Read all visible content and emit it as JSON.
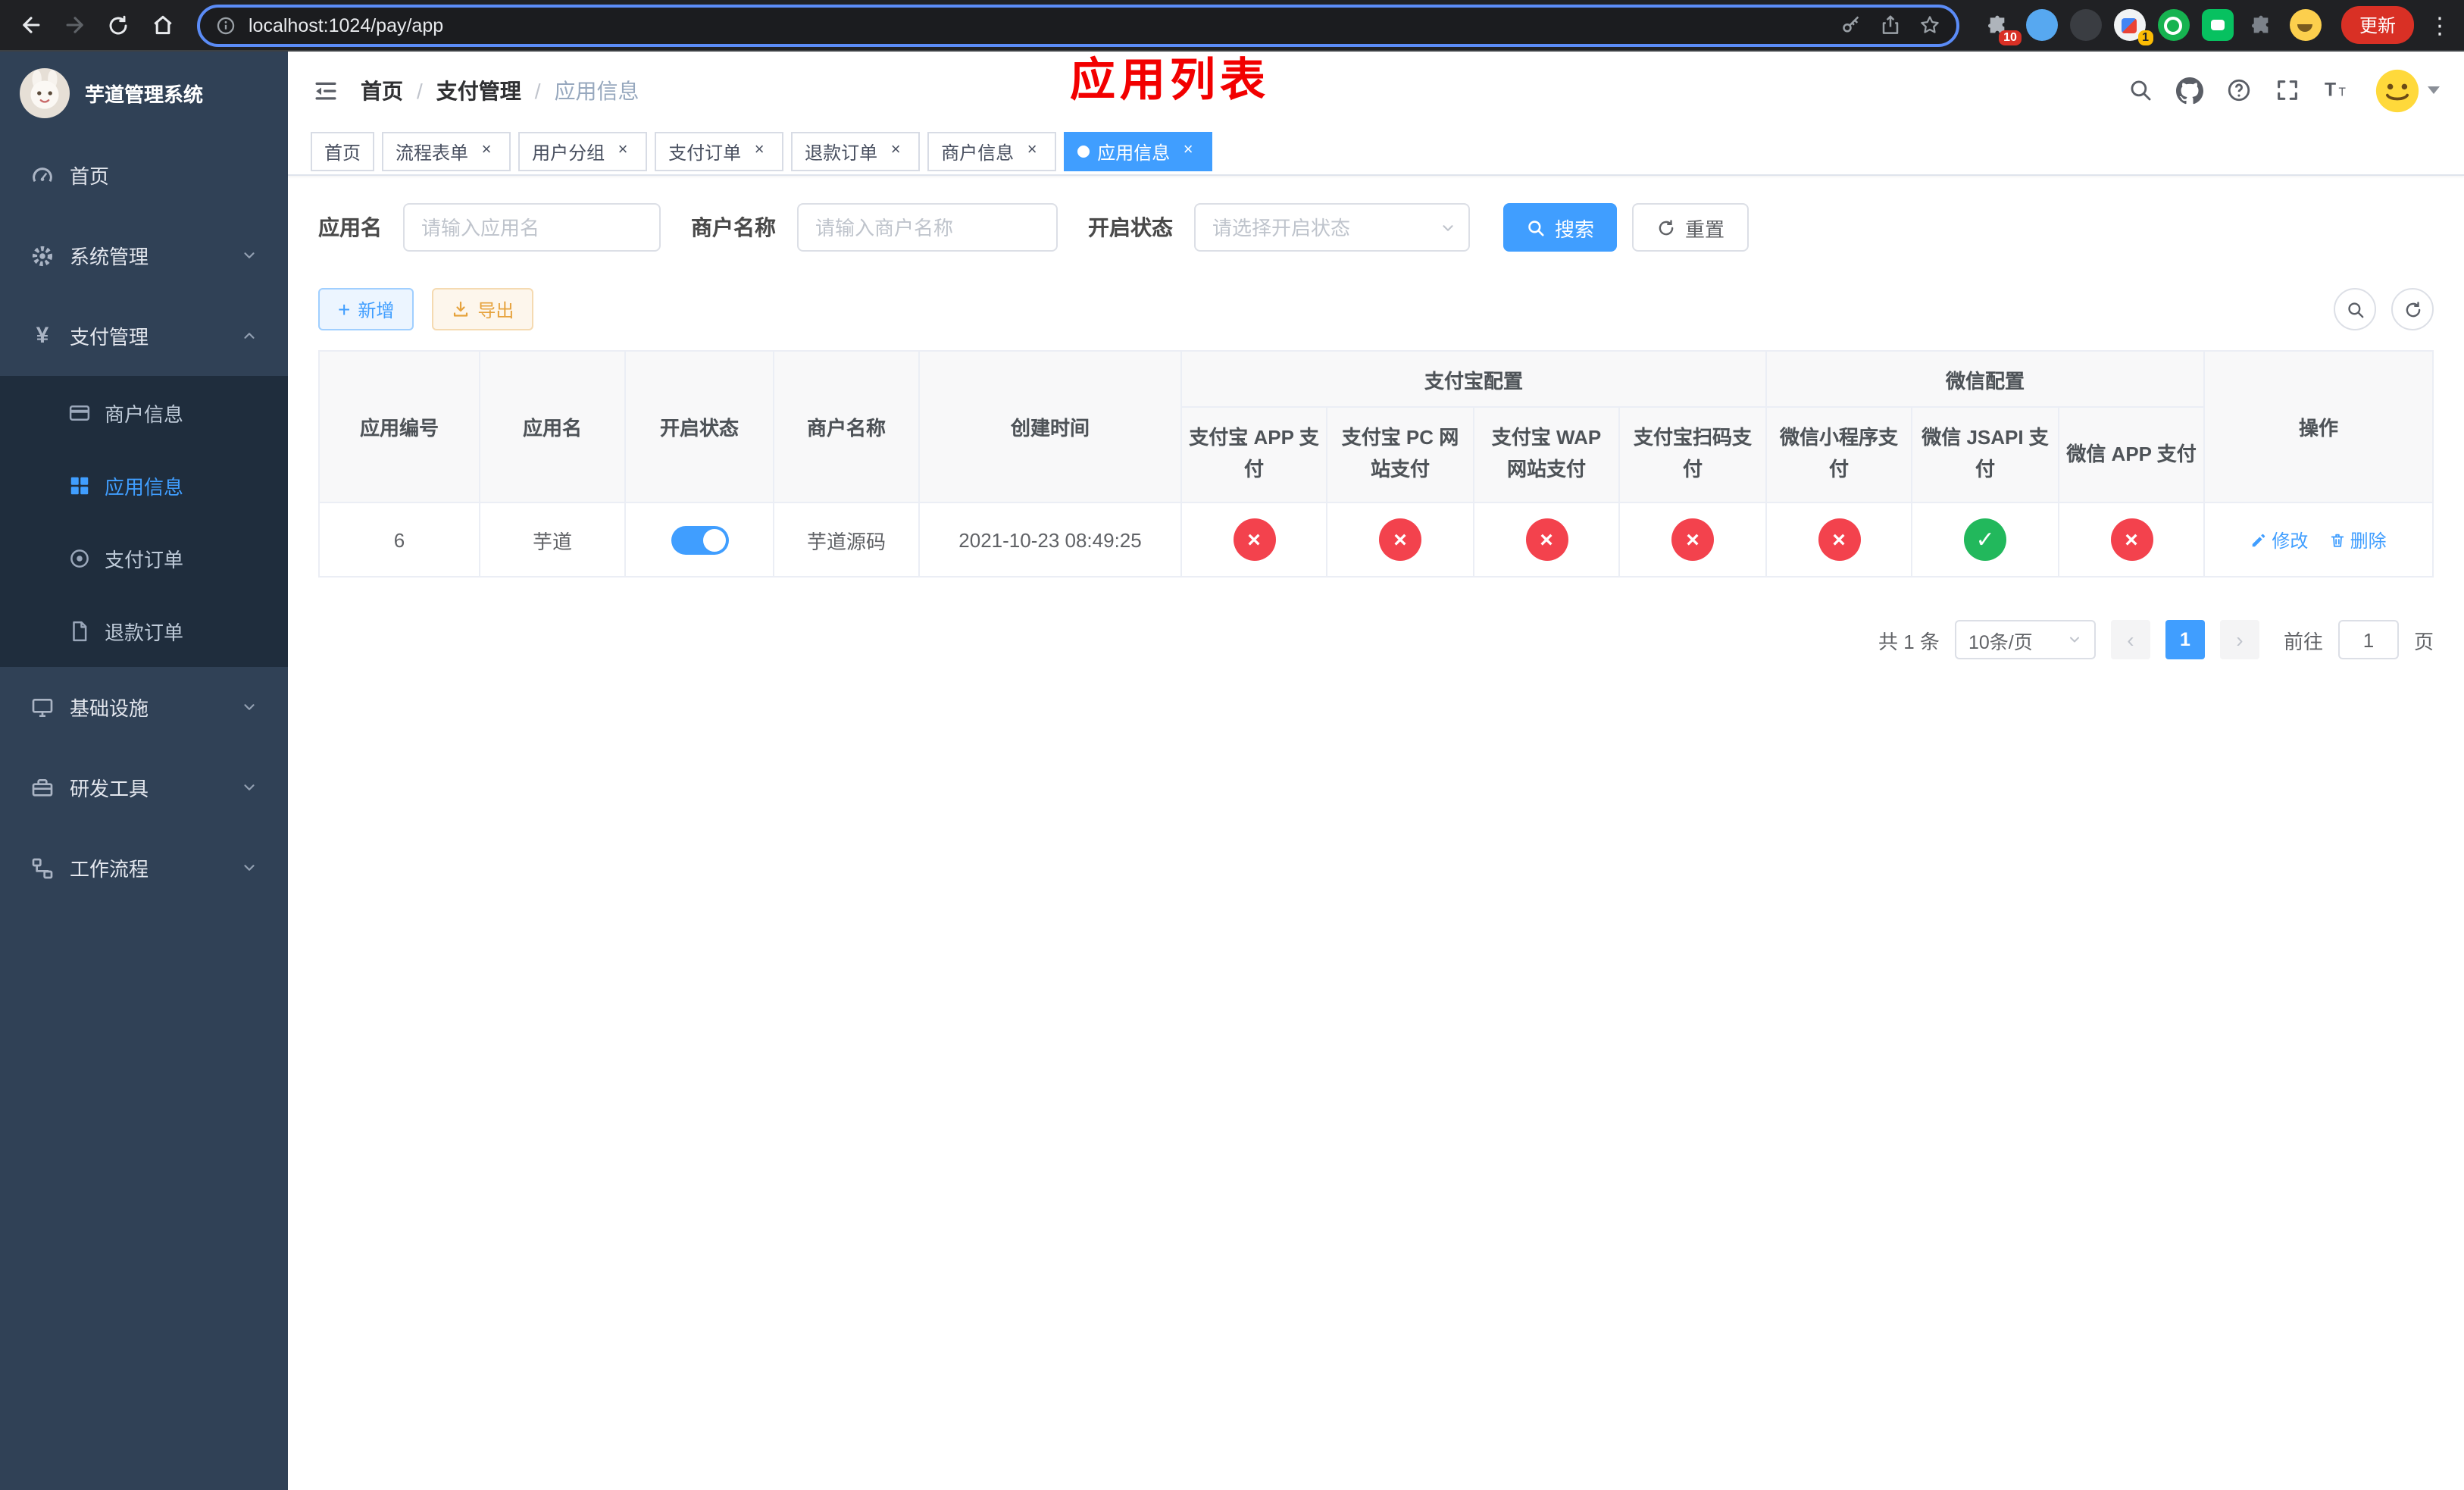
{
  "browser": {
    "url": "localhost:1024/pay/app",
    "update_label": "更新",
    "ext_badge_1": "10",
    "ext_badge_2": "1"
  },
  "sidebar": {
    "title": "芋道管理系统",
    "items": [
      {
        "label": "首页"
      },
      {
        "label": "系统管理",
        "expandable": true
      },
      {
        "label": "支付管理",
        "expanded": true,
        "children": [
          {
            "label": "商户信息"
          },
          {
            "label": "应用信息",
            "active": true
          },
          {
            "label": "支付订单"
          },
          {
            "label": "退款订单"
          }
        ]
      },
      {
        "label": "基础设施",
        "expandable": true
      },
      {
        "label": "研发工具",
        "expandable": true
      },
      {
        "label": "工作流程",
        "expandable": true
      }
    ]
  },
  "navbar": {
    "breadcrumb": [
      "首页",
      "支付管理",
      "应用信息"
    ],
    "annotation": "应用列表"
  },
  "tabs": [
    {
      "label": "首页",
      "closable": false
    },
    {
      "label": "流程表单",
      "closable": true
    },
    {
      "label": "用户分组",
      "closable": true
    },
    {
      "label": "支付订单",
      "closable": true
    },
    {
      "label": "退款订单",
      "closable": true
    },
    {
      "label": "商户信息",
      "closable": true
    },
    {
      "label": "应用信息",
      "closable": true,
      "active": true
    }
  ],
  "filters": {
    "app_name_label": "应用名",
    "app_name_placeholder": "请输入应用名",
    "merchant_label": "商户名称",
    "merchant_placeholder": "请输入商户名称",
    "status_label": "开启状态",
    "status_placeholder": "请选择开启状态",
    "search_label": "搜索",
    "reset_label": "重置"
  },
  "toolbar": {
    "add_label": "新增",
    "export_label": "导出"
  },
  "table": {
    "group_alipay": "支付宝配置",
    "group_wechat": "微信配置",
    "columns": [
      "应用编号",
      "应用名",
      "开启状态",
      "商户名称",
      "创建时间",
      "支付宝 APP 支付",
      "支付宝 PC 网站支付",
      "支付宝 WAP 网站支付",
      "支付宝扫码支付",
      "微信小程序支付",
      "微信 JSAPI 支付",
      "微信 APP 支付",
      "操作"
    ],
    "row": {
      "id": "6",
      "name": "芋道",
      "status_on": true,
      "merchant": "芋道源码",
      "created_at": "2021-10-23 08:49:25",
      "configs": {
        "alipay_app": false,
        "alipay_pc": false,
        "alipay_wap": false,
        "alipay_qr": false,
        "wechat_lite": false,
        "wechat_jsapi": true,
        "wechat_app": false
      },
      "edit_label": "修改",
      "delete_label": "删除"
    }
  },
  "pagination": {
    "total": "共 1 条",
    "page_size": "10条/页",
    "current_page": "1",
    "goto_label": "前往",
    "goto_value": "1",
    "page_unit": "页"
  },
  "ui": {
    "cross_glyph": "×",
    "check_glyph": "✓",
    "close_glyph": "×",
    "prev_glyph": "‹",
    "next_glyph": "›",
    "kebab_glyph": "⋮",
    "breadcrumb_sep": "/",
    "plus_glyph": "+"
  },
  "colors": {
    "primary": "#409eff",
    "danger": "#f3424d",
    "success": "#22b85c",
    "warning": "#e6a23c",
    "annotation": "#f20000",
    "sidebar_bg": "#304156",
    "submenu_bg": "#1f2d3d",
    "update_button": "#d93025"
  }
}
